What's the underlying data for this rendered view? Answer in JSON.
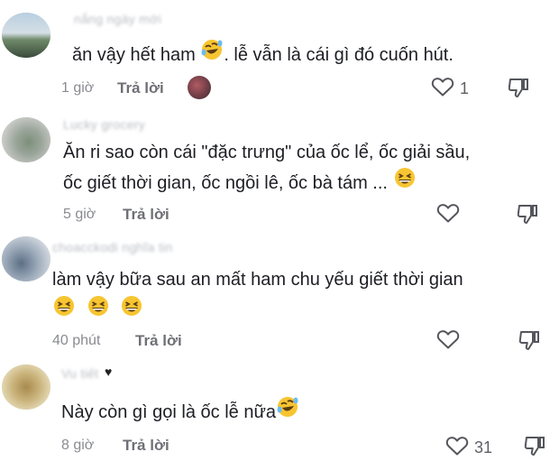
{
  "comments": [
    {
      "username": "nắng ngày mới",
      "text_before": "ăn vậy hết ham ",
      "text_after": ". lễ vẫn là cái gì đó cuốn hút.",
      "time": "1 giờ",
      "reply_label": "Trả lời",
      "likes": "1"
    },
    {
      "username": "Lucky grocery",
      "line1": "Ăn ri sao còn cái \"đặc trưng\" của ốc lể, ốc giải sầu,",
      "line2": "ốc giết thời gian, ốc ngồi lê, ốc bà tám ... ",
      "time": "5 giờ",
      "reply_label": "Trả lời",
      "likes": ""
    },
    {
      "username": "choacckodi nghĩa tin",
      "line1": "làm vậy bữa sau an mất ham chu yếu giết thời gian",
      "time": "40 phút",
      "reply_label": "Trả lời",
      "likes": ""
    },
    {
      "username": "Vu tiết",
      "text": "Này còn gì gọi là ốc lễ nữa",
      "time": "8 giờ",
      "reply_label": "Trả lời",
      "likes": "31"
    }
  ],
  "icons": {
    "like": "heart-outline-icon",
    "dislike": "thumbs-down-outline-icon",
    "rofl": "rolling-on-floor-laughing-emoji",
    "grin": "grinning-squinting-emoji"
  }
}
